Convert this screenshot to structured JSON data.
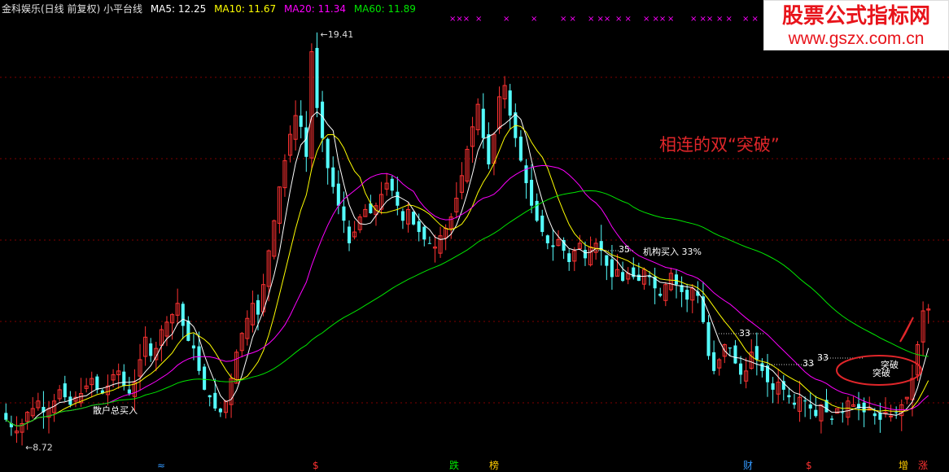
{
  "header": {
    "title": "金科娱乐(日线 前复权) 小平台线",
    "ma5": "MA5: 12.25",
    "ma10": "MA10: 11.67",
    "ma20": "MA20: 11.34",
    "ma60": "MA60: 11.89"
  },
  "watermark": {
    "line1": "股票公式指标网",
    "line2": "www.gszx.com.cn"
  },
  "annotation": "相连的双“突破”",
  "colors": {
    "up": "#ff3232",
    "down": "#54fcfc",
    "ma5": "#ffffff",
    "ma10": "#ffff00",
    "ma20": "#ff00ff",
    "ma60": "#00e600",
    "grid": "#800000",
    "annotation": "#e0262a"
  },
  "chart_data": {
    "type": "candlestick",
    "yrange": [
      8.3,
      20.0
    ],
    "grid": true,
    "high_label": "19.41",
    "low_label": "8.72",
    "close": [
      9.3,
      9.1,
      9.0,
      9.2,
      9.5,
      9.6,
      9.8,
      9.5,
      9.6,
      9.8,
      10.1,
      9.9,
      9.7,
      9.9,
      10.0,
      10.2,
      10.4,
      10.1,
      10.0,
      10.2,
      10.5,
      10.6,
      10.2,
      10.0,
      10.3,
      10.9,
      11.5,
      11.0,
      11.2,
      11.7,
      11.9,
      12.1,
      12.4,
      11.8,
      11.4,
      11.2,
      10.6,
      10.1,
      9.9,
      9.6,
      9.5,
      9.8,
      10.4,
      11.1,
      11.6,
      12.0,
      12.4,
      12.1,
      12.9,
      13.8,
      14.6,
      15.5,
      16.2,
      16.9,
      17.4,
      17.1,
      16.3,
      19.1,
      17.6,
      16.8,
      16.0,
      15.5,
      15.0,
      14.6,
      14.0,
      14.3,
      14.7,
      14.9,
      14.8,
      15.0,
      15.3,
      15.6,
      15.4,
      15.0,
      14.6,
      14.9,
      14.5,
      14.3,
      14.1,
      14.0,
      13.9,
      14.2,
      14.4,
      14.7,
      15.2,
      15.8,
      16.5,
      17.1,
      17.7,
      16.8,
      16.1,
      16.9,
      17.9,
      18.2,
      17.4,
      16.8,
      16.2,
      15.6,
      15.0,
      14.6,
      14.3,
      14.0,
      13.9,
      14.1,
      13.8,
      13.5,
      13.8,
      14.0,
      13.6,
      13.9,
      14.0,
      13.8,
      13.4,
      13.1,
      13.3,
      13.0,
      13.2,
      13.1,
      13.0,
      13.3,
      13.1,
      12.8,
      12.6,
      12.9,
      13.2,
      12.9,
      12.7,
      12.5,
      12.8,
      12.6,
      11.9,
      11.0,
      10.6,
      10.9,
      11.3,
      11.2,
      10.8,
      10.5,
      10.6,
      11.1,
      10.9,
      10.6,
      10.3,
      10.1,
      10.3,
      10.1,
      9.9,
      9.7,
      9.9,
      9.8,
      9.6,
      9.4,
      9.7,
      9.5,
      9.3,
      9.6,
      9.5,
      9.8,
      9.7,
      9.6,
      9.5,
      9.6,
      9.4,
      9.3,
      9.5,
      9.4,
      9.5,
      9.7,
      9.9,
      10.4,
      11.3,
      12.2,
      12.25
    ],
    "ma_labels": [
      "MA5",
      "MA10",
      "MA20",
      "MA60"
    ],
    "labels": [
      {
        "text": "散户总买入",
        "color": "#ffffff"
      },
      {
        "text": "机构买入 33%",
        "color": "#ffffff"
      },
      {
        "text": "35",
        "color": "#ffffff"
      },
      {
        "text": "33",
        "color": "#ffffff"
      },
      {
        "text": "33",
        "color": "#ffffff"
      },
      {
        "text": "33",
        "color": "#ffffff"
      },
      {
        "text": "突破",
        "color": "#ffffff"
      },
      {
        "text": "突破",
        "color": "#ffffff"
      }
    ],
    "top_markers": [
      "×××",
      "×",
      "×",
      "×",
      "× ×",
      "× ××",
      "× ×",
      "× ××",
      "×",
      "× ××",
      "× ×",
      "× ×",
      "×××"
    ],
    "bottom_markers": [
      {
        "text": "≈",
        "color": "#3399ff"
      },
      {
        "text": "$",
        "color": "#ff3232"
      },
      {
        "text": "跌",
        "color": "#00e600"
      },
      {
        "text": "榜",
        "color": "#ffcc00"
      },
      {
        "text": "财",
        "color": "#3399ff"
      },
      {
        "text": "$",
        "color": "#ff3232"
      },
      {
        "text": "增",
        "color": "#ffcc00"
      },
      {
        "text": "涨",
        "color": "#ff3232"
      }
    ]
  }
}
